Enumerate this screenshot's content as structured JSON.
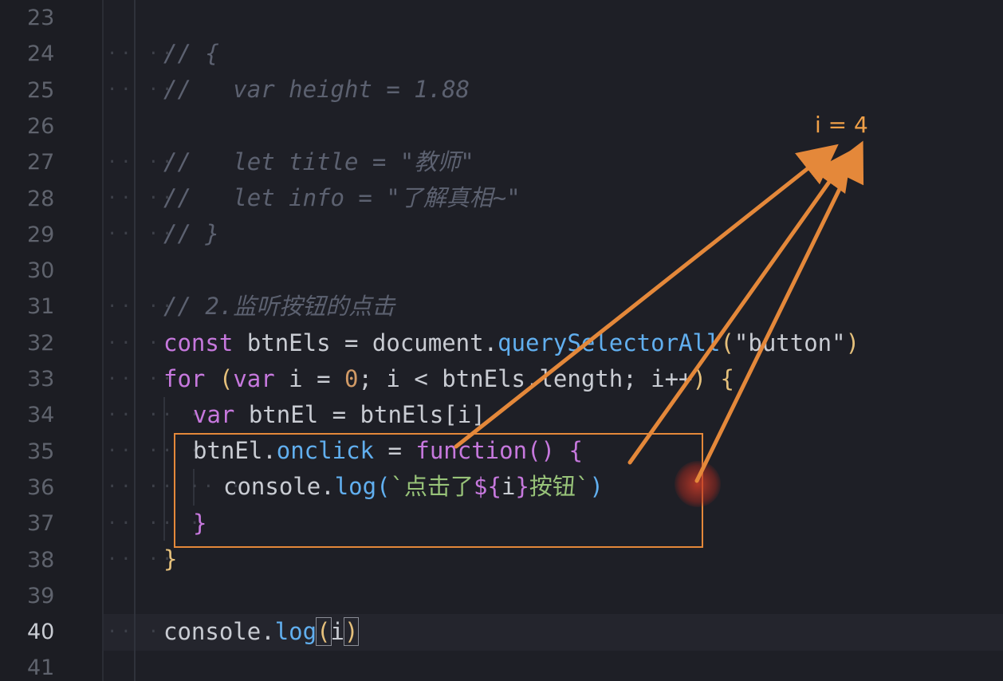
{
  "gutter": {
    "line_numbers": [
      "23",
      "24",
      "25",
      "26",
      "27",
      "28",
      "29",
      "30",
      "31",
      "32",
      "33",
      "34",
      "35",
      "36",
      "37",
      "38",
      "39",
      "40",
      "41"
    ],
    "active_line": "40"
  },
  "code": {
    "l24": "// {",
    "l25": "//   var height = 1.88",
    "l27": "//   let title = \"教师\"",
    "l28": "//   let info = \"了解真相~\"",
    "l29": "// }",
    "l31": "// 2.监听按钮的点击",
    "l32": {
      "kw": "const",
      "name": " btnEls ",
      "eq": "=",
      "obj": " document.",
      "method": "querySelectorAll",
      "open": "(",
      "arg": "\"button\"",
      "close": ")"
    },
    "l33": {
      "kw": "for",
      "open": " (",
      "kw2": "var",
      "init": " i = ",
      "zero": "0",
      "rest": "; i < btnEls.length; i++",
      "close": ")",
      "brace": " {"
    },
    "l34": {
      "kw": "var",
      "rest": " btnEl = btnEls[i]"
    },
    "l35": {
      "obj": "btnEl.",
      "prop": "onclick",
      "eq": " = ",
      "kw": "function",
      "parens": "()",
      "brace": " {"
    },
    "l36": {
      "obj": "console.",
      "method": "log",
      "open": "(",
      "tpl_start": "`点击了",
      "interp_open": "${",
      "interp_var": "i",
      "interp_close": "}",
      "tpl_end": "按钮`",
      "close": ")"
    },
    "l37": "}",
    "l38": "}",
    "l40": {
      "obj": "console.",
      "method": "log",
      "open": "(",
      "arg": "i",
      "close": ")"
    }
  },
  "annotation": {
    "text": "i = 4",
    "color": "#f0a048"
  },
  "colors": {
    "background": "#1e1f26",
    "arrow": "#e4883a",
    "box": "#e4883a"
  }
}
